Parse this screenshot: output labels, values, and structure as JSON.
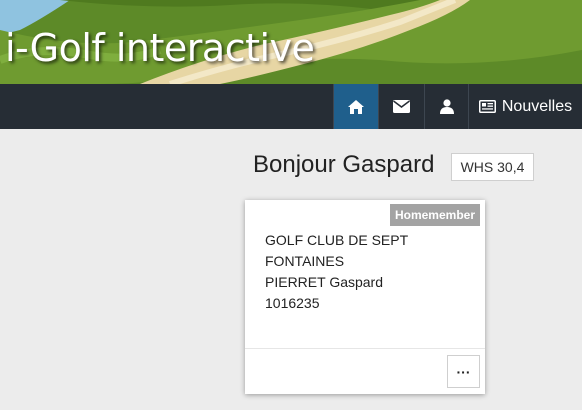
{
  "header": {
    "title": "i-Golf interactive"
  },
  "nav": {
    "home_icon": "home-icon",
    "mail_icon": "envelope-icon",
    "user_icon": "user-icon",
    "news_icon": "newspaper-icon",
    "news_label": "Nouvelles",
    "active_color": "#1f5f8c",
    "bar_color": "#262d35"
  },
  "main": {
    "greeting": "Bonjour Gaspard",
    "whs": "WHS 30,4"
  },
  "card": {
    "role": "Homemember",
    "lines": [
      "GOLF CLUB DE SEPT",
      "FONTAINES",
      "PIERRET Gaspard",
      "1016235"
    ],
    "more_label": "···"
  }
}
